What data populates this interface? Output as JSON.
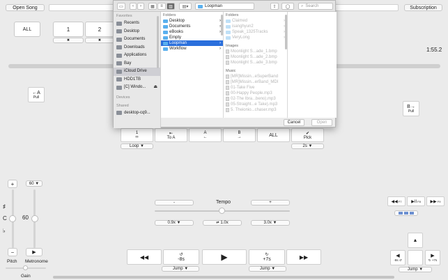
{
  "top": {
    "open_song": "Open Song",
    "subscription": "Subscription"
  },
  "markers": {
    "all": "ALL",
    "m1": "1",
    "m2": "2",
    "x": "✖"
  },
  "time": "1:55.2",
  "loop_points": {
    "left_arrow": "←A",
    "left_sub": "Pull",
    "right_arrow": "B→",
    "right_sub": "Pull"
  },
  "loop_row": [
    {
      "icon": "1",
      "sub": "∞"
    },
    {
      "icon": "⇤",
      "sub": "To A"
    },
    {
      "icon": "A",
      "sub": "←"
    },
    {
      "icon": "B",
      "sub": "→"
    },
    {
      "icon": "ALL",
      "sub": ""
    },
    {
      "icon": "✔",
      "sub": "Pick"
    }
  ],
  "loop_menu": "Loop ▼",
  "pick_menu": "2s ▼",
  "pitch": {
    "up": "+",
    "down": "−",
    "sharp": "♯",
    "note": "C",
    "flat": "♭",
    "label": "Pitch"
  },
  "metronome": {
    "bpm_menu": "60 ▼",
    "value": "60",
    "play": "▶",
    "label": "Metronome"
  },
  "gain": "Gain",
  "tempo": {
    "minus": "-",
    "plus": "+",
    "label": "Tempo",
    "slow": "0.9x ▼",
    "normal": "1.0x",
    "normal_icon": "⇄",
    "fast": "3.0x ▼"
  },
  "transport": {
    "rewind": "◀◀",
    "back_icon": "↺",
    "back": "-8s",
    "play": "▶",
    "fwd_icon": "↻",
    "fwd": "+7s",
    "ffwd": "▶▶",
    "jump_left": "Jump ▼",
    "jump_right": "Jump ▼"
  },
  "right_panel": {
    "prev": "◀◀",
    "prev_key": "F7",
    "playpause": "▶II",
    "playpause_key": "F8",
    "next": "▶▶",
    "next_key": "F9",
    "up": "▲",
    "left": "◀",
    "left_sub": "-8s ↺",
    "right": "▶",
    "right_sub": "↻ +7s",
    "jump": "Jump ▼"
  },
  "dialog": {
    "location": "Loopman",
    "search_placeholder": "Search",
    "sidebar_fav": "Favorites",
    "sidebar_items": [
      "Recents",
      "Desktop",
      "Documents",
      "Downloads",
      "Applications",
      "Bay",
      "iCloud Drive",
      "HDD1TB",
      "[C] Windo..."
    ],
    "sidebar_devices": "Devices",
    "sidebar_shared": "Shared",
    "shared_items": [
      "desktop-cq9..."
    ],
    "col1_header": "Folders",
    "col1_items": [
      "Desktop",
      "Documents",
      "eBooks",
      "Empty",
      "Loopman",
      "Workflow"
    ],
    "col2_folders_header": "Folders",
    "col2_folders": [
      "Claimed",
      "isanghyun2",
      "Speak_1325Tracks",
      "VeryLong"
    ],
    "col2_images_header": "Images",
    "col2_images": [
      "Moonlight S...ade_1.bmp",
      "Moonlight S...ade_2.bmp",
      "Moonlight S...ade_3.bmp"
    ],
    "col2_music_header": "Music",
    "col2_music": [
      "[MR]Missin...eSuperBand",
      "[MR]Missin...erBand_MDI",
      "01-Take Five",
      "00-Happy People.mp3",
      "02-The Ibra...beno).mp3",
      "05-Straight...e Take).mp3",
      "5. Theionio...chaser.mp3"
    ],
    "cancel": "Cancel",
    "open": "Open"
  },
  "colors": {
    "accent": "#2a6fdc",
    "folder": "#5ab0ee"
  }
}
